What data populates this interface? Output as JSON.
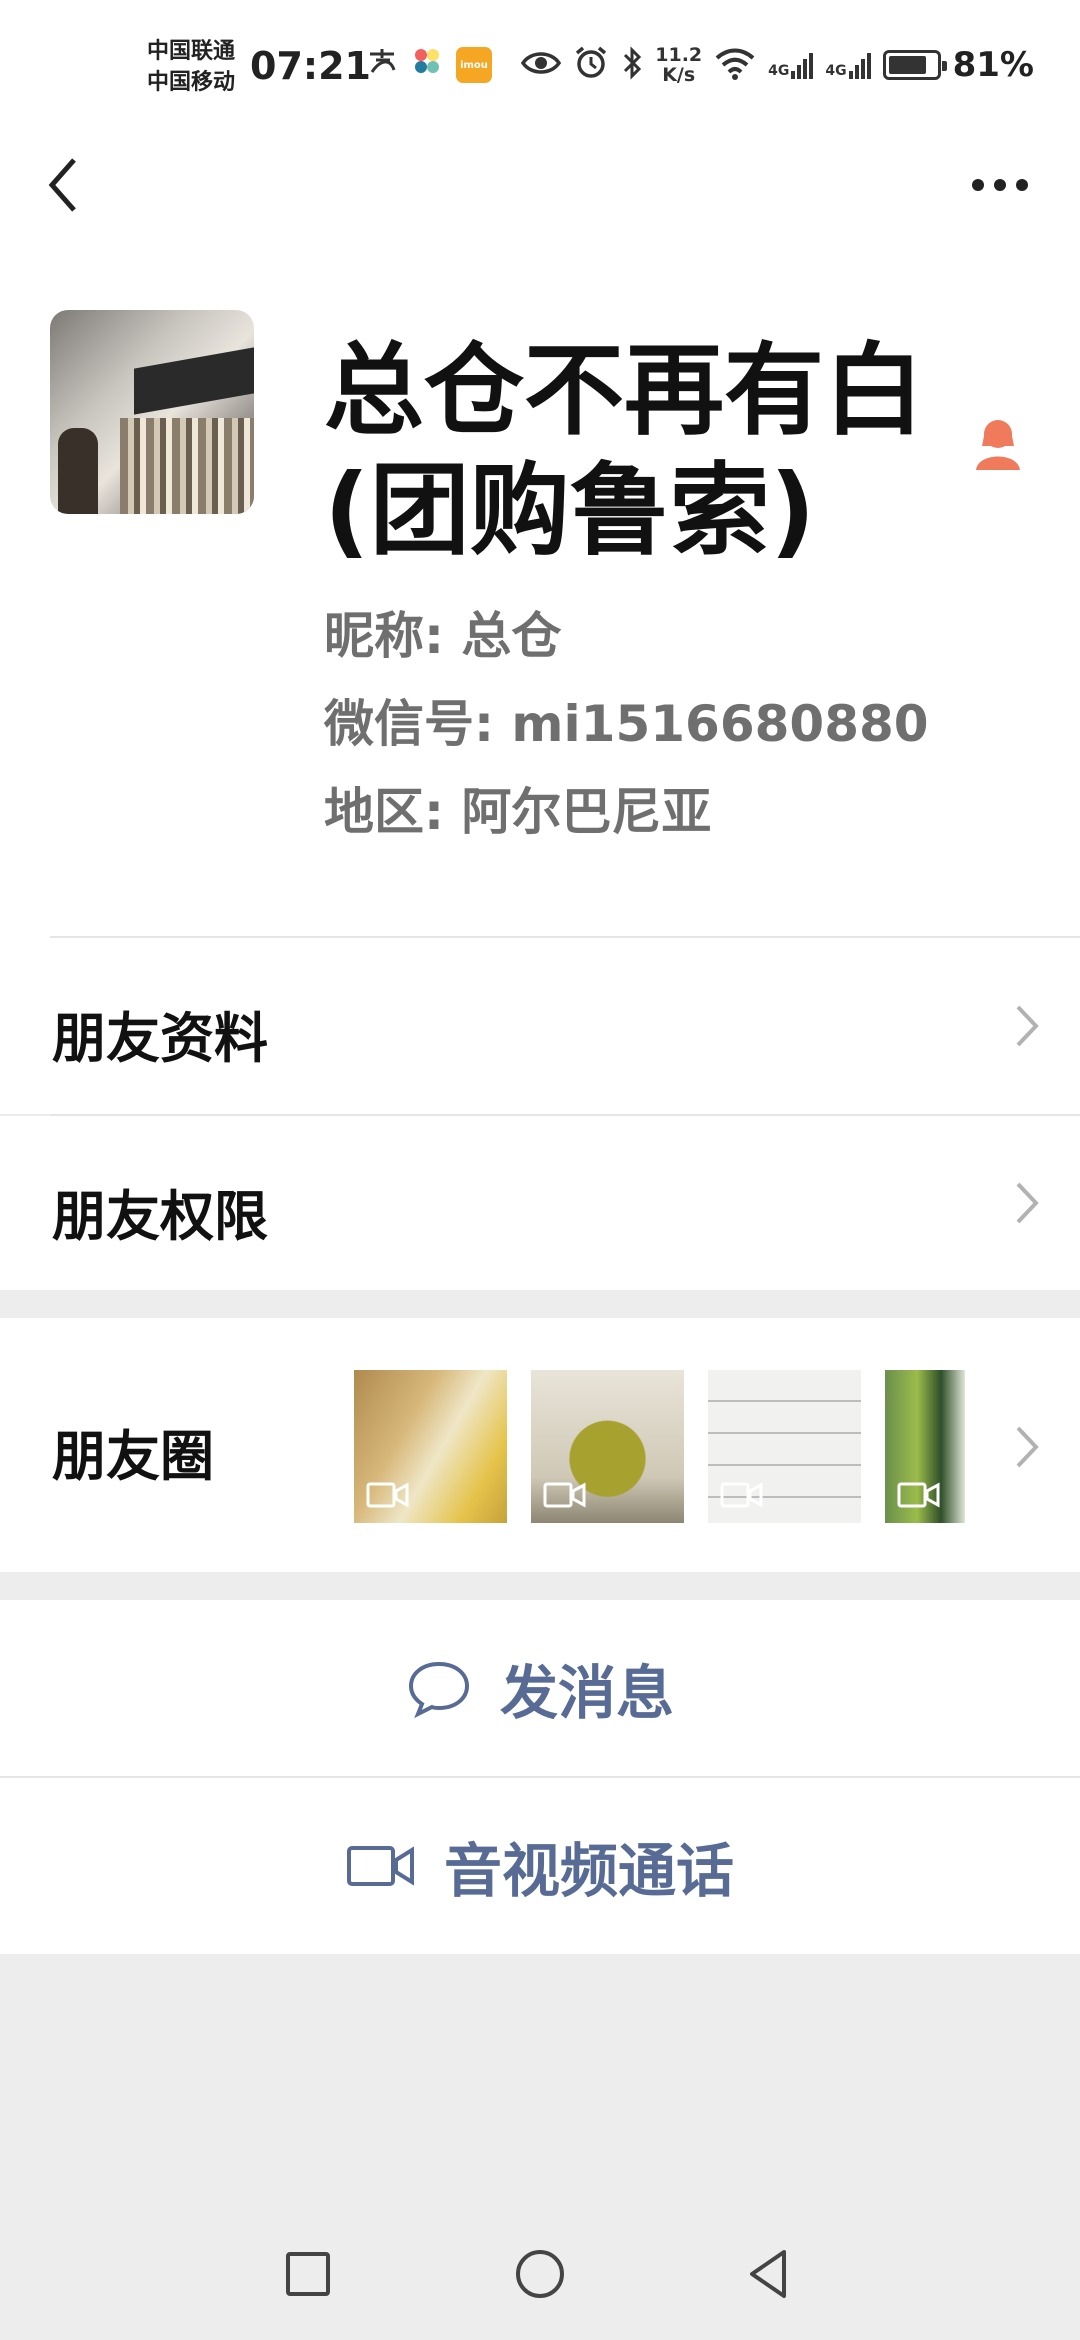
{
  "status_bar": {
    "carrier_1": "中国联通",
    "carrier_2": "中国移动",
    "time": "07:21",
    "app_badge": "imou",
    "net_speed_value": "11.2",
    "net_speed_unit": "K/s",
    "signal_1": "4G",
    "signal_2": "4G",
    "battery": "81%",
    "battery_level": 0.81
  },
  "header": {
    "back_icon": "chevron-left-icon",
    "more_icon": "more-dots-icon"
  },
  "profile": {
    "remark_name_line1": "总仓不再有白",
    "remark_name_line2": "(团购鲁索)",
    "nickname_label": "昵称:",
    "nickname": "总仓",
    "wechat_id_label": "微信号:",
    "wechat_id": "mi1516680880",
    "region_label": "地区:",
    "region": "阿尔巴尼亚",
    "gender_icon": "female-icon",
    "gender_color": "#f07a5c"
  },
  "menu": {
    "friend_profile": "朋友资料",
    "friend_permissions": "朋友权限",
    "moments": "朋友圈"
  },
  "actions": {
    "send_message": "发消息",
    "video_call": "音视频通话",
    "accent_color": "#576b95"
  }
}
